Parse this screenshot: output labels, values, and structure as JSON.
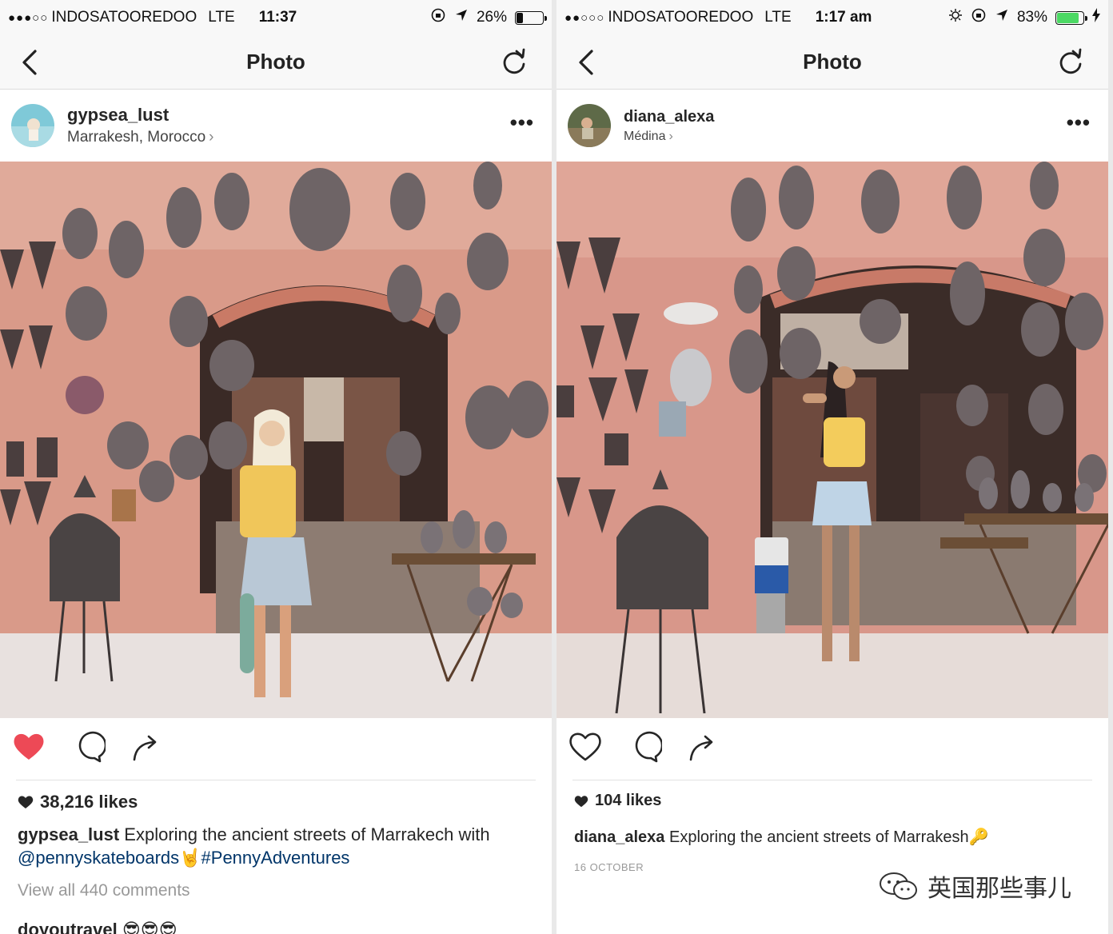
{
  "left": {
    "status": {
      "dots": "●●●○○",
      "carrier": "INDOSATOOREDOO",
      "network": "LTE",
      "time": "11:37",
      "battery": "26%",
      "battery_level": 0.26
    },
    "nav": {
      "title": "Photo"
    },
    "post": {
      "username": "gypsea_lust",
      "location": "Marrakesh, Morocco",
      "likes": "38,216 likes",
      "liked": true,
      "caption_user": "gypsea_lust",
      "caption_text": "Exploring the ancient streets of Marrakech with",
      "mention": "@pennyskateboards",
      "emoji": "🤘",
      "hashtag": "#PennyAdventures",
      "view_comments": "View all 440 comments",
      "comment_user": "doyoutravel",
      "comment_emoji": "😎😎😎"
    }
  },
  "right": {
    "status": {
      "dots": "●●○○○",
      "carrier": "INDOSATOOREDOO",
      "network": "LTE",
      "time": "1:17 am",
      "battery": "83%",
      "battery_level": 0.83
    },
    "nav": {
      "title": "Photo"
    },
    "post": {
      "username": "diana_alexa",
      "location": "Médina",
      "likes": "104 likes",
      "liked": false,
      "caption_user": "diana_alexa",
      "caption_text": "Exploring the ancient streets of Marrakesh",
      "caption_emoji": "🔑",
      "date": "16 OCTOBER"
    }
  },
  "watermark": {
    "text": "英国那些事儿"
  },
  "colors": {
    "heart": "#ed4956",
    "wall": "#d89a8a",
    "link": "#003569",
    "battery_green": "#4cd964"
  }
}
